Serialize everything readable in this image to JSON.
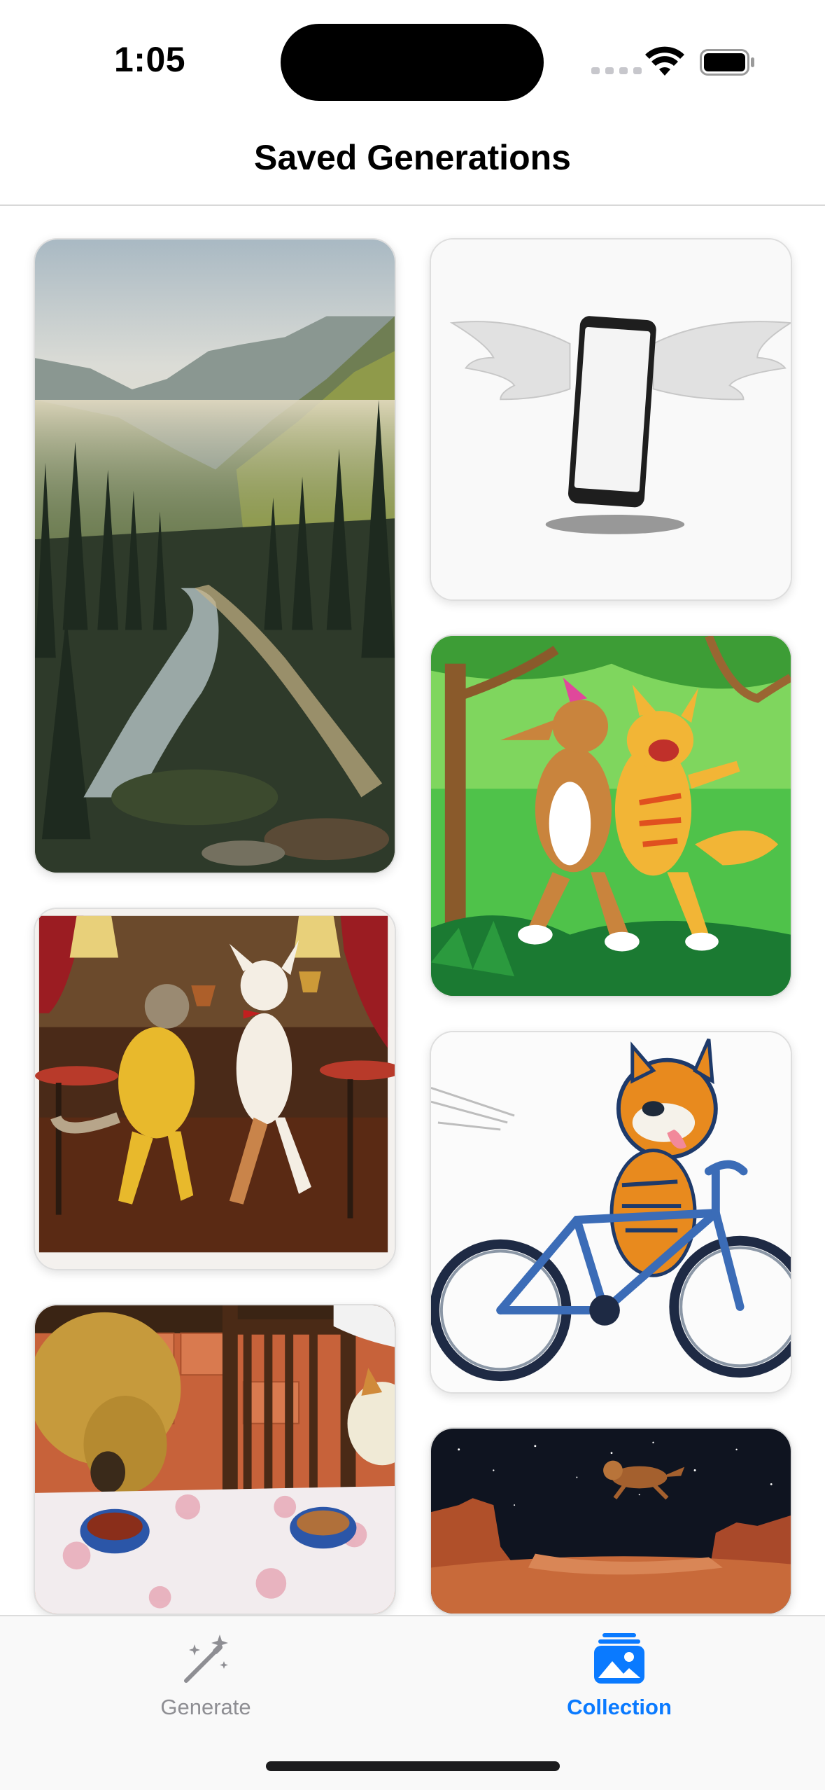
{
  "status_bar": {
    "time": "1:05",
    "wifi_icon": "wifi-icon",
    "battery_icon": "battery-icon"
  },
  "nav": {
    "title": "Saved Generations"
  },
  "gallery": {
    "items": [
      {
        "subject": "misty mountain valley with pine forest and stream"
      },
      {
        "subject": "smartphone with angel wings"
      },
      {
        "subject": "cartoon dog and cat dancing in forest"
      },
      {
        "subject": "cat and dog dancing in a bar painting"
      },
      {
        "subject": "cartoon cat riding a bicycle"
      },
      {
        "subject": "dog and cat eating from bowls at a table"
      },
      {
        "subject": "dog flying over red desert canyon"
      }
    ]
  },
  "tab_bar": {
    "tabs": [
      {
        "label": "Generate",
        "icon": "wand-sparkles-icon",
        "selected": false
      },
      {
        "label": "Collection",
        "icon": "photo-stack-icon",
        "selected": true
      }
    ],
    "accent_color": "#0a7aff",
    "inactive_color": "#8e8e93"
  }
}
